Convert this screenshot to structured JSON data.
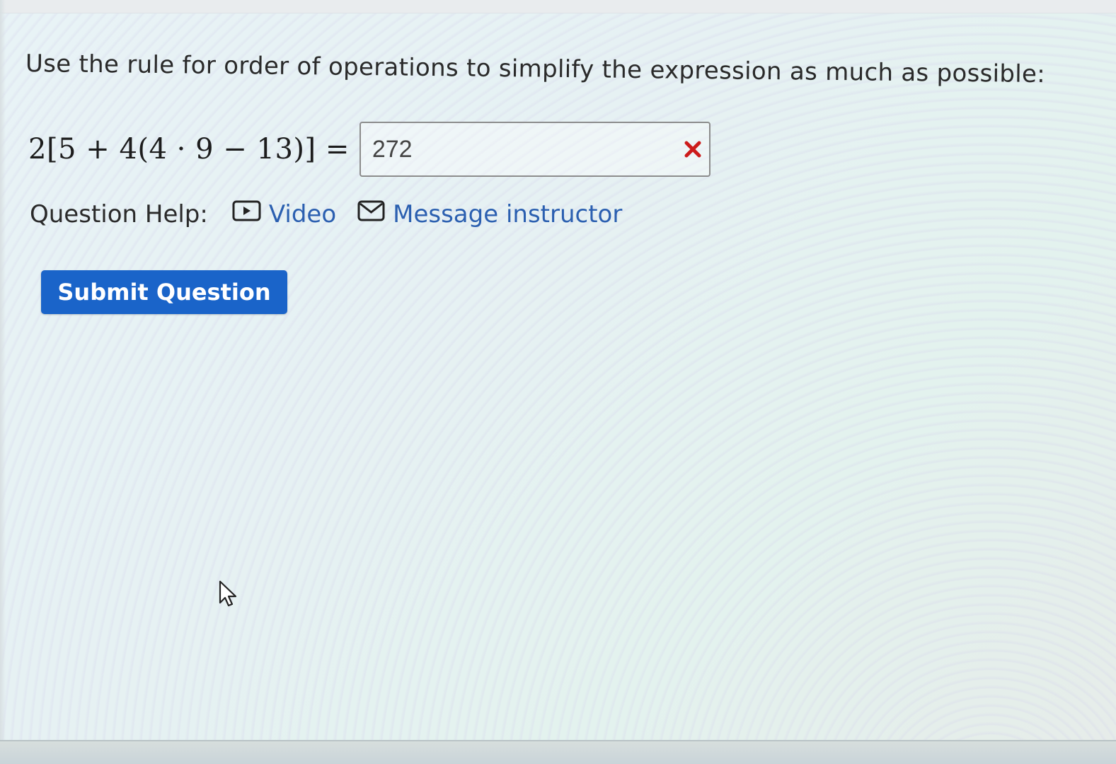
{
  "question": {
    "prompt": "Use the rule for order of operations to simplify the expression as much as possible:"
  },
  "equation": {
    "expression": "2[5 + 4(4 · 9 − 13)] =",
    "answer_value": "272",
    "status": "incorrect",
    "status_icon": "x-mark-icon",
    "status_color": "#cc1b1b"
  },
  "help": {
    "label": "Question Help:",
    "video_label": "Video",
    "video_icon": "play-icon",
    "message_label": "Message instructor",
    "message_icon": "envelope-icon",
    "link_color": "#2b5fb0"
  },
  "actions": {
    "submit_label": "Submit Question",
    "submit_color": "#1a64c9"
  }
}
